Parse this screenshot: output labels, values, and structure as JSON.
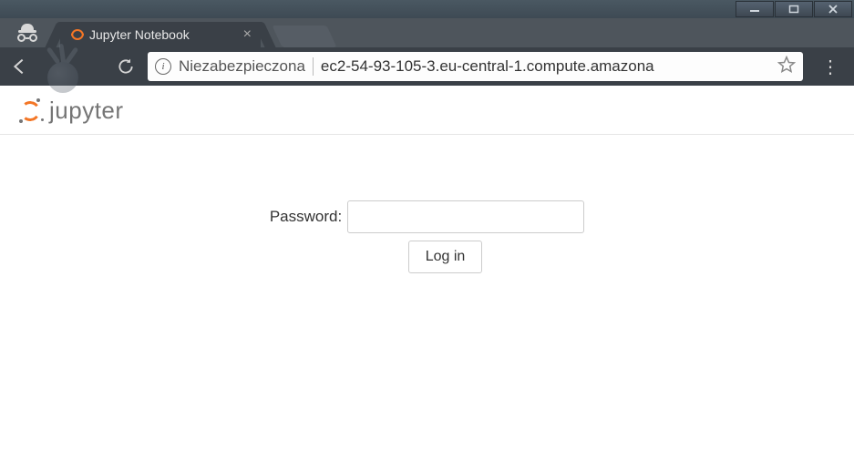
{
  "window": {
    "minimize": "—",
    "maximize": "□",
    "close": "×"
  },
  "browser": {
    "tab_title": "Jupyter Notebook",
    "security_text": "Niezabezpieczona",
    "url": "ec2-54-93-105-3.eu-central-1.compute.amazona",
    "info_glyph": "i"
  },
  "page": {
    "logo_text": "jupyter",
    "password_label": "Password:",
    "password_value": "",
    "login_button": "Log in"
  }
}
